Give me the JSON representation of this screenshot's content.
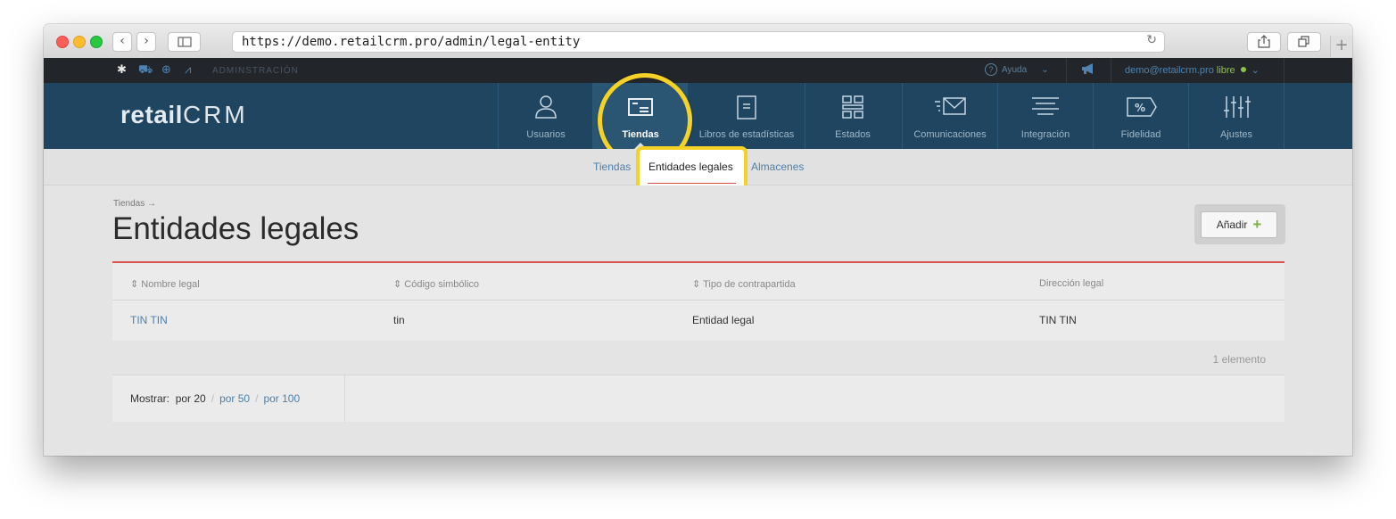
{
  "browser": {
    "url": "https://demo.retailcrm.pro/admin/legal-entity",
    "back_icon": "chevron-left-icon",
    "forward_icon": "chevron-right-icon",
    "reload_icon": "reload-icon"
  },
  "adminbar": {
    "label": "ADMINSTRACIÓN",
    "help_label": "Ayuda",
    "user_email": "demo@retailcrm.pro",
    "user_status": "libre"
  },
  "logo": {
    "text_retail": "retail",
    "text_crm": "CRM"
  },
  "mainnav": {
    "items": [
      {
        "label": "Usuarios",
        "icon": "user-icon"
      },
      {
        "label": "Tiendas",
        "icon": "store-window-icon"
      },
      {
        "label": "Libros de estadísticas",
        "icon": "book-icon"
      },
      {
        "label": "Estados",
        "icon": "grid-icon"
      },
      {
        "label": "Comunicaciones",
        "icon": "envelope-icon"
      },
      {
        "label": "Integración",
        "icon": "lines-icon"
      },
      {
        "label": "Fidelidad",
        "icon": "percent-tag-icon"
      },
      {
        "label": "Ajustes",
        "icon": "sliders-icon"
      }
    ]
  },
  "subnav": {
    "items": [
      "Tiendas",
      "Entidades legales",
      "Almacenes"
    ]
  },
  "page": {
    "breadcrumb": "Tiendas →",
    "title": "Entidades legales",
    "add_button": "Añadir"
  },
  "table": {
    "headers": [
      "Nombre legal",
      "Código simbólico",
      "Tipo de contrapartida",
      "Dirección legal"
    ],
    "rows": [
      [
        "TIN TIN",
        "tin",
        "Entidad legal",
        "TIN TIN"
      ]
    ],
    "count_label": "1 elemento"
  },
  "pager": {
    "show_label": "Mostrar:",
    "options": [
      "por 20",
      "por 50",
      "por 100"
    ]
  },
  "colors": {
    "nav_bg": "#1f4560",
    "highlight": "#f6d227",
    "accent_red": "#d9534f",
    "link": "#4f7fa8"
  }
}
